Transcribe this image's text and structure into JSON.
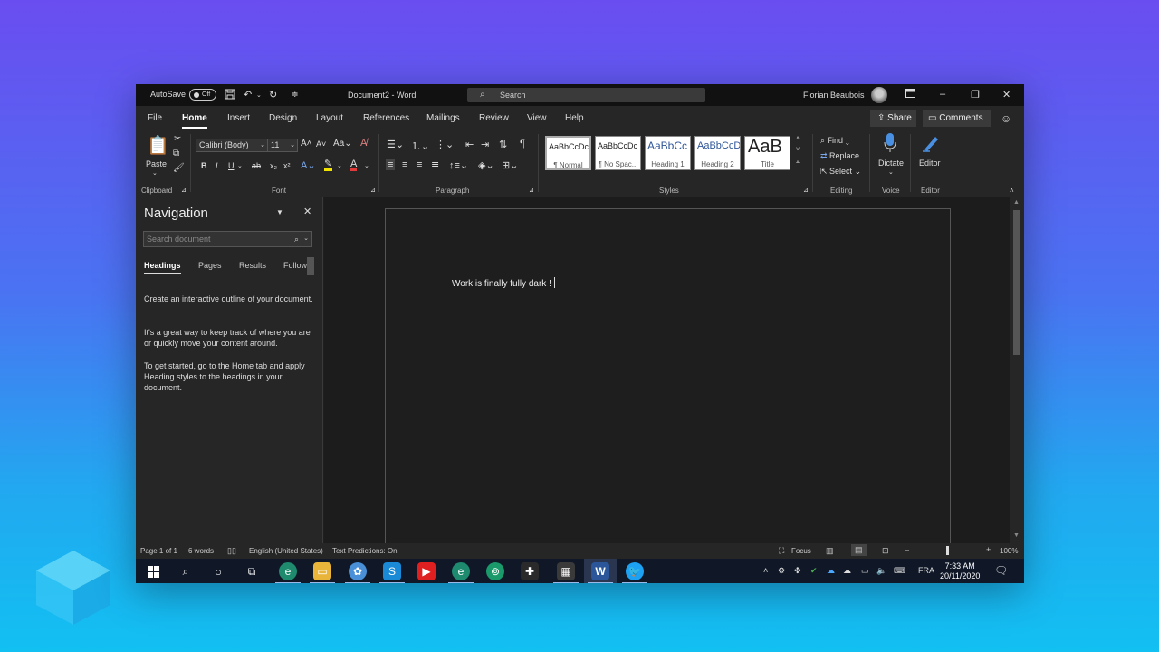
{
  "titlebar": {
    "autosave_label": "AutoSave",
    "autosave_state": "Off",
    "doc_title": "Document2 - Word",
    "search_placeholder": "Search",
    "user_name": "Florian Beaubois"
  },
  "tabs": [
    "File",
    "Home",
    "Insert",
    "Design",
    "Layout",
    "References",
    "Mailings",
    "Review",
    "View",
    "Help"
  ],
  "active_tab": "Home",
  "share_label": "Share",
  "comments_label": "Comments",
  "ribbon": {
    "paste_label": "Paste",
    "font_name": "Calibri (Body)",
    "font_size": "11",
    "groups": {
      "clipboard": "Clipboard",
      "font": "Font",
      "paragraph": "Paragraph",
      "styles": "Styles",
      "editing": "Editing",
      "voice": "Voice",
      "editor": "Editor"
    },
    "styles": [
      {
        "sample": "AaBbCcDc",
        "name": "¶ Normal"
      },
      {
        "sample": "AaBbCcDc",
        "name": "¶ No Spac..."
      },
      {
        "sample": "AaBbCc",
        "name": "Heading 1"
      },
      {
        "sample": "AaBbCcD",
        "name": "Heading 2"
      },
      {
        "sample": "AaB",
        "name": "Title"
      }
    ],
    "find_label": "Find",
    "replace_label": "Replace",
    "select_label": "Select",
    "dictate_label": "Dictate",
    "editor_label": "Editor"
  },
  "navigation": {
    "title": "Navigation",
    "search_placeholder": "Search document",
    "tabs": [
      "Headings",
      "Pages",
      "Results",
      "Follow"
    ],
    "p1": "Create an interactive outline of your document.",
    "p2": "It's a great way to keep track of where you are or quickly move your content around.",
    "p3": "To get started, go to the Home tab and apply Heading styles to the headings in your document."
  },
  "document": {
    "text": "Work is finally fully dark !"
  },
  "statusbar": {
    "page": "Page 1 of 1",
    "words": "6 words",
    "language": "English (United States)",
    "predictions": "Text Predictions: On",
    "focus": "Focus",
    "zoom": "100%"
  },
  "taskbar": {
    "lang": "FRA",
    "time": "7:33 AM",
    "date": "20/11/2020"
  },
  "colors": {
    "word_blue": "#2b579a",
    "dark_bg": "#1f1f1f"
  }
}
